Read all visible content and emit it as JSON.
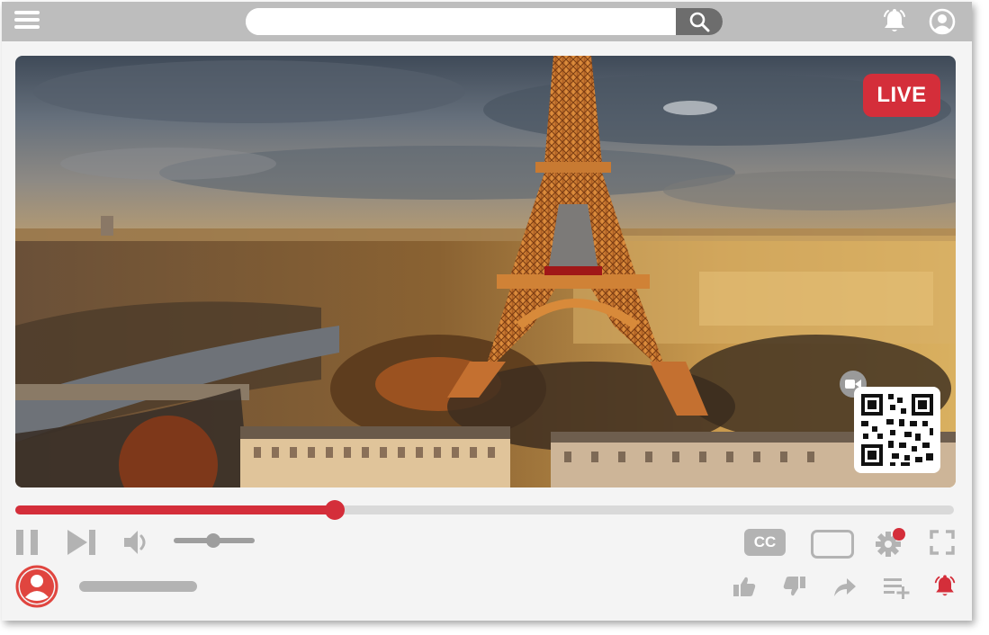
{
  "search": {
    "placeholder": "",
    "value": ""
  },
  "badge": {
    "label": "LIVE",
    "color": "#d42e3a"
  },
  "player": {
    "progress_fraction": 0.34,
    "volume_fraction": 0.49
  },
  "controls": {
    "cc_label": "CC"
  },
  "colors": {
    "accent": "#d42e3a",
    "topbar": "#bdbdbd",
    "icon_gray": "#b3b3b3"
  },
  "icons": {
    "menu": "hamburger-menu-icon",
    "search": "search-icon",
    "notifications": "bell-icon",
    "account": "user-account-icon",
    "camera": "video-camera-icon",
    "qr": "qr-code-icon",
    "pause": "pause-icon",
    "next": "skip-next-icon",
    "volume": "volume-icon",
    "settings": "gear-icon",
    "fullscreen": "fullscreen-icon",
    "like": "thumbs-up-icon",
    "dislike": "thumbs-down-icon",
    "share": "share-arrow-icon",
    "playlist": "add-to-playlist-icon",
    "subscribe_bell": "subscribe-bell-icon"
  }
}
